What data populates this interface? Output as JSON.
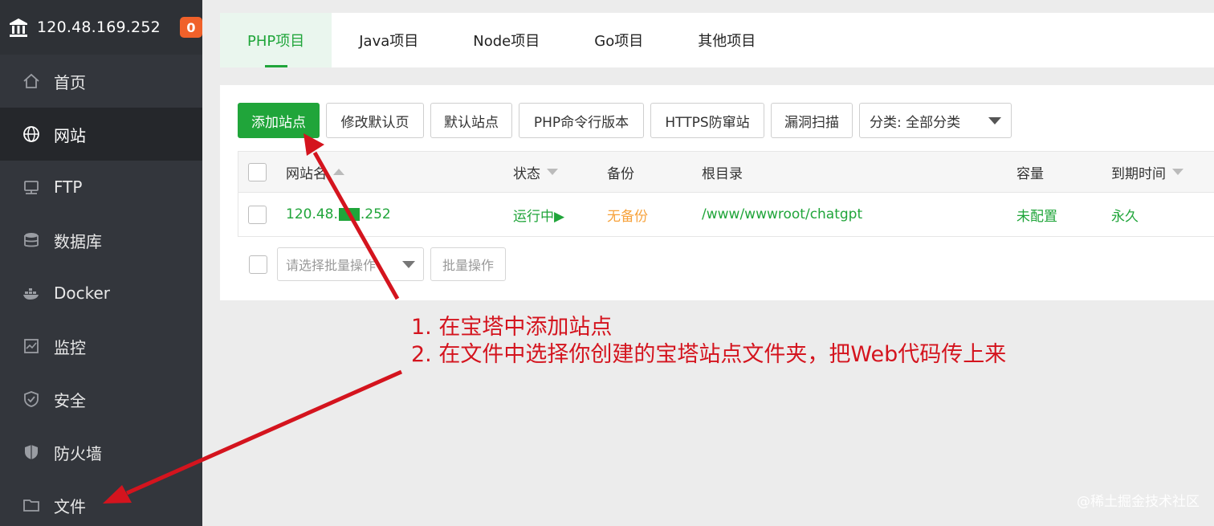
{
  "sidebar": {
    "server_ip": "120.48.169.252",
    "badge_count": "0",
    "items": [
      {
        "label": "首页",
        "icon": "home-icon"
      },
      {
        "label": "网站",
        "icon": "globe-icon"
      },
      {
        "label": "FTP",
        "icon": "ftp-icon"
      },
      {
        "label": "数据库",
        "icon": "database-icon"
      },
      {
        "label": "Docker",
        "icon": "docker-icon"
      },
      {
        "label": "监控",
        "icon": "monitor-icon"
      },
      {
        "label": "安全",
        "icon": "shield-icon"
      },
      {
        "label": "防火墙",
        "icon": "firewall-icon"
      },
      {
        "label": "文件",
        "icon": "folder-icon"
      }
    ],
    "active_index": 1
  },
  "tabs": [
    {
      "label": "PHP项目"
    },
    {
      "label": "Java项目"
    },
    {
      "label": "Node项目"
    },
    {
      "label": "Go项目"
    },
    {
      "label": "其他项目"
    }
  ],
  "toolbar": {
    "add_site": "添加站点",
    "modify_default_page": "修改默认页",
    "default_site": "默认站点",
    "php_cli_version": "PHP命令行版本",
    "https_anti_hijack": "HTTPS防窜站",
    "vuln_scan": "漏洞扫描",
    "category_select": "分类: 全部分类"
  },
  "table": {
    "headers": {
      "site_name": "网站名",
      "status": "状态",
      "backup": "备份",
      "root_dir": "根目录",
      "capacity": "容量",
      "expire": "到期时间"
    },
    "rows": [
      {
        "site_name_prefix": "120.48.",
        "site_name_suffix": ".252",
        "status": "运行中▶",
        "backup": "无备份",
        "root_dir": "/www/wwwroot/chatgpt",
        "capacity": "未配置",
        "expire": "永久"
      }
    ]
  },
  "batch": {
    "placeholder": "请选择批量操作",
    "button": "批量操作"
  },
  "annotation": {
    "line1": "1. 在宝塔中添加站点",
    "line2": "2. 在文件中选择你创建的宝塔站点文件夹，把Web代码传上来"
  },
  "watermark": "@稀土掘金技术社区",
  "colors": {
    "accent_green": "#20a53a",
    "badge_orange": "#f0612a",
    "annotation_red": "#d4141e",
    "sidebar_bg": "#33363c"
  }
}
